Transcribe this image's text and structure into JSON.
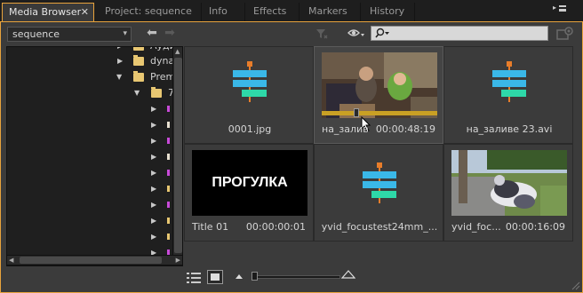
{
  "tabs": [
    {
      "label": "Media Browser",
      "close": "✕"
    },
    {
      "label": "Project: sequence"
    },
    {
      "label": "Info"
    },
    {
      "label": "Effects"
    },
    {
      "label": "Markers"
    },
    {
      "label": "History"
    }
  ],
  "toolbar": {
    "location": "sequence",
    "caret": "▾",
    "back": "⬅",
    "forward": "➡",
    "search_placeholder": ""
  },
  "tree": {
    "items": [
      {
        "label": "Аудио",
        "expanded": false
      },
      {
        "label": "dyna",
        "expanded": false
      },
      {
        "label": "Prem",
        "expanded": true
      },
      {
        "label": "7",
        "expanded": true
      }
    ],
    "marker_colors": [
      "#c84ad8",
      "#e8e0d0",
      "#c84ad8",
      "#e8e0d0",
      "#c84ad8",
      "#e8c772",
      "#c84ad8",
      "#e8c772",
      "#e8c772",
      "#c84ad8"
    ]
  },
  "grid": {
    "items": [
      {
        "name": "0001.jpg",
        "duration": "",
        "kind": "sequence"
      },
      {
        "name": "на_залив",
        "duration": "00:00:48:19",
        "kind": "video-kids",
        "selected": true,
        "scrub_progress": 0.28
      },
      {
        "name": "на_заливе 23.avi",
        "duration": "",
        "kind": "sequence"
      },
      {
        "name": "Title 01",
        "duration": "00:00:00:01",
        "kind": "title",
        "title_text": "ПРОГУЛКА"
      },
      {
        "name": "yvid_focustest24mm_...",
        "duration": "",
        "kind": "sequence"
      },
      {
        "name": "yvid_foc...",
        "duration": "00:00:16:09",
        "kind": "video-dog"
      }
    ]
  },
  "colors": {
    "accent": "#e8a33c",
    "panel_bg": "#3b3b3b",
    "tree_bg": "#1f1f1f",
    "seq_orange": "#e87d2a",
    "seq_blue": "#3ab8e8",
    "seq_green": "#2ed8a8"
  }
}
